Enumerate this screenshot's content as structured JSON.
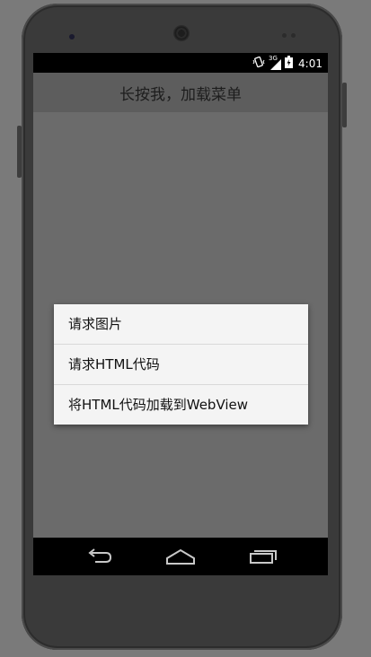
{
  "status_bar": {
    "time": "4:01",
    "icons": [
      "vibrate-icon",
      "signal-3g-icon",
      "battery-icon"
    ],
    "network_label": "3G"
  },
  "action_bar": {
    "title": "长按我，加载菜单"
  },
  "context_menu": {
    "items": [
      {
        "label": "请求图片"
      },
      {
        "label": "请求HTML代码"
      },
      {
        "label": "将HTML代码加载到WebView"
      }
    ]
  },
  "nav_bar": {
    "buttons": [
      "back-icon",
      "home-icon",
      "recents-icon"
    ]
  },
  "colors": {
    "screen_dim": "#6f6f6f",
    "dialog_bg": "#f4f4f4",
    "device_body": "#3a3a3a"
  }
}
